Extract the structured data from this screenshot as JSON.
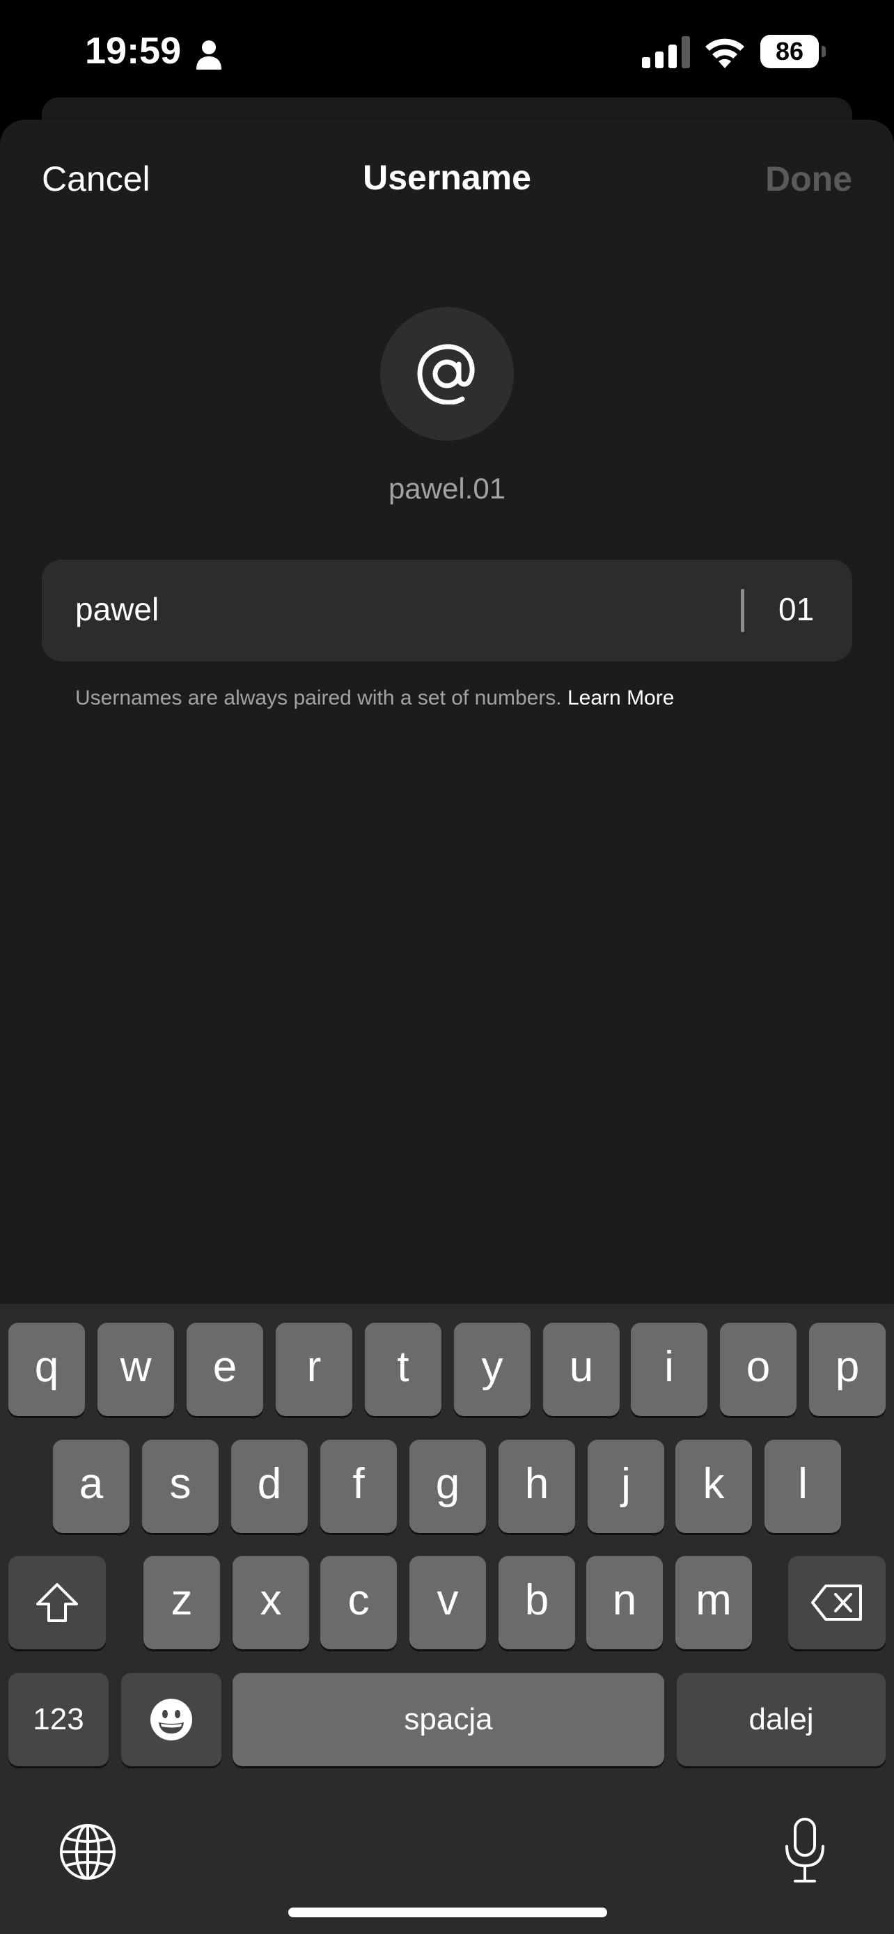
{
  "status": {
    "time": "19:59",
    "battery": "86"
  },
  "nav": {
    "cancel": "Cancel",
    "title": "Username",
    "done": "Done"
  },
  "avatar": {
    "icon": "at-icon",
    "preview": "pawel.01"
  },
  "field": {
    "value": "pawel",
    "suffix": "01"
  },
  "helper": {
    "text": "Usernames are always paired with a set of numbers.",
    "link": "Learn More"
  },
  "keyboard": {
    "row1": [
      "q",
      "w",
      "e",
      "r",
      "t",
      "y",
      "u",
      "i",
      "o",
      "p"
    ],
    "row2": [
      "a",
      "s",
      "d",
      "f",
      "g",
      "h",
      "j",
      "k",
      "l"
    ],
    "row3": [
      "z",
      "x",
      "c",
      "v",
      "b",
      "n",
      "m"
    ],
    "numbers": "123",
    "space": "spacja",
    "return": "dalej"
  }
}
